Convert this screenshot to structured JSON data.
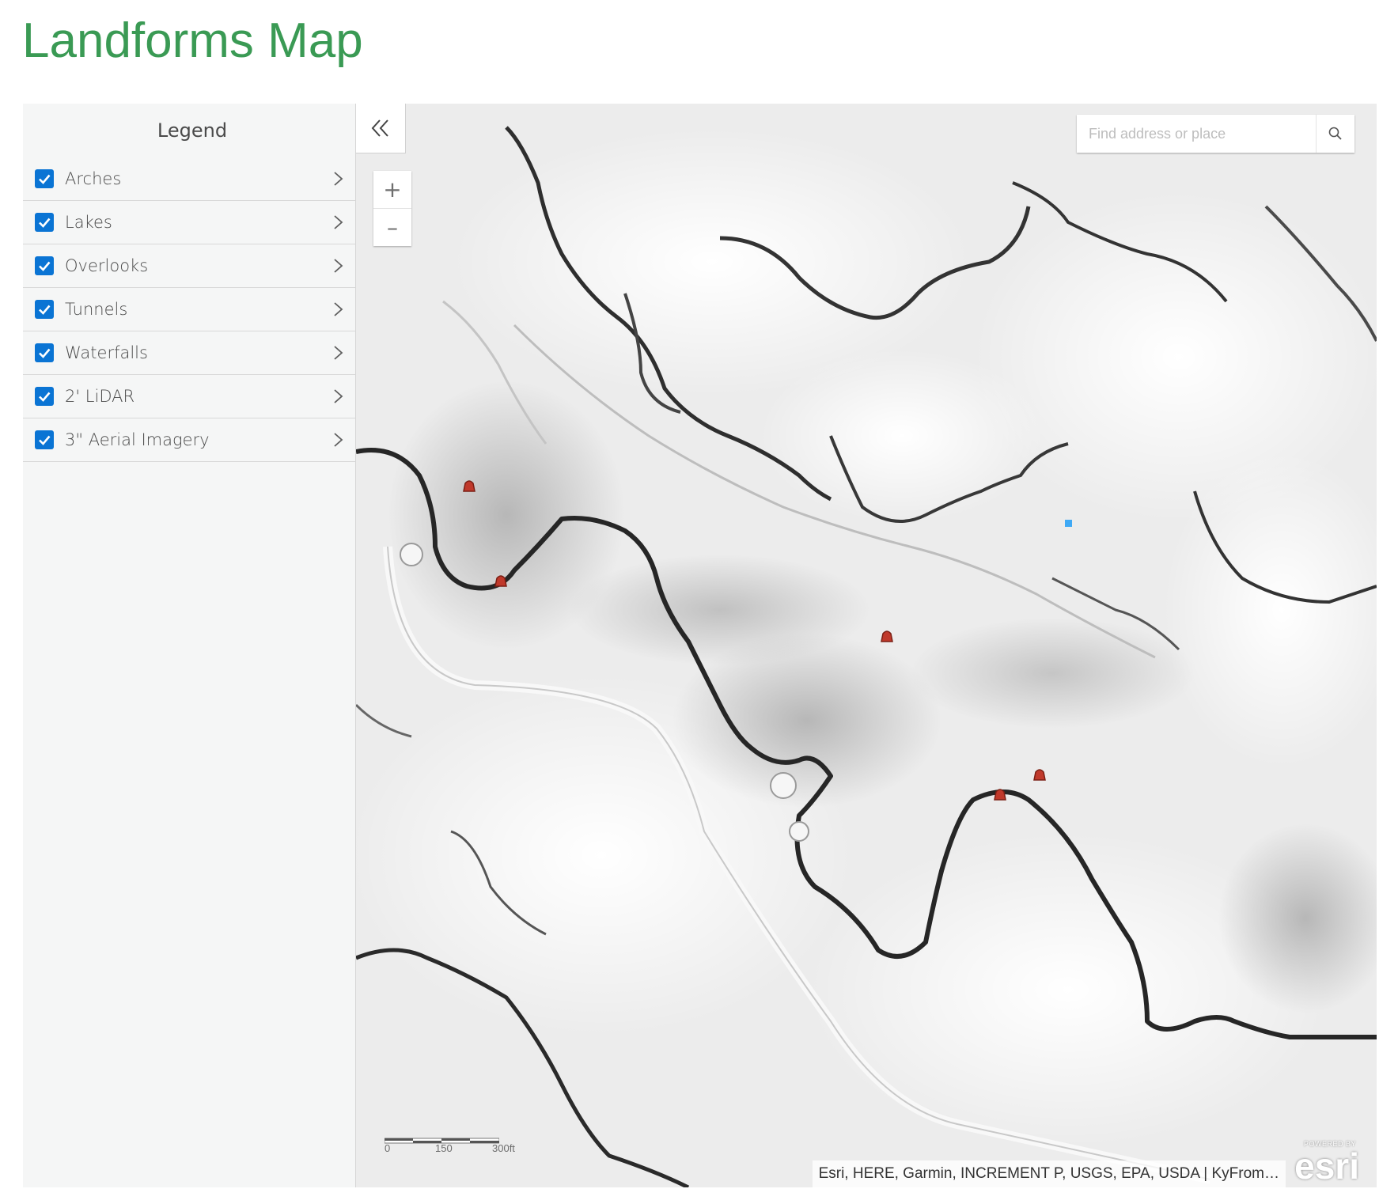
{
  "page": {
    "title": "Landforms Map"
  },
  "legend": {
    "heading": "Legend",
    "layers": [
      {
        "label": "Arches",
        "checked": true
      },
      {
        "label": "Lakes",
        "checked": true
      },
      {
        "label": "Overlooks",
        "checked": true
      },
      {
        "label": "Tunnels",
        "checked": true
      },
      {
        "label": "Waterfalls",
        "checked": true
      },
      {
        "label": "2' LiDAR",
        "checked": true
      },
      {
        "label": "3\" Aerial Imagery",
        "checked": true
      }
    ]
  },
  "map": {
    "basemap": "hillshade",
    "accent_color": "#0a74d4",
    "arch_marker_color": "#c0392b",
    "lake_marker_color": "#3fa9f5",
    "collapse_icon": "double-chevron-left-icon",
    "zoom": {
      "in_label": "+",
      "out_label": "–"
    },
    "search": {
      "placeholder": "Find address or place"
    },
    "scale": {
      "labels": [
        "0",
        "150",
        "300ft"
      ]
    },
    "attribution": "Esri, HERE, Garmin, INCREMENT P, USGS, EPA, USDA | KyFrom…",
    "logo": {
      "powered_by": "POWERED BY",
      "wordmark": "esri"
    }
  }
}
